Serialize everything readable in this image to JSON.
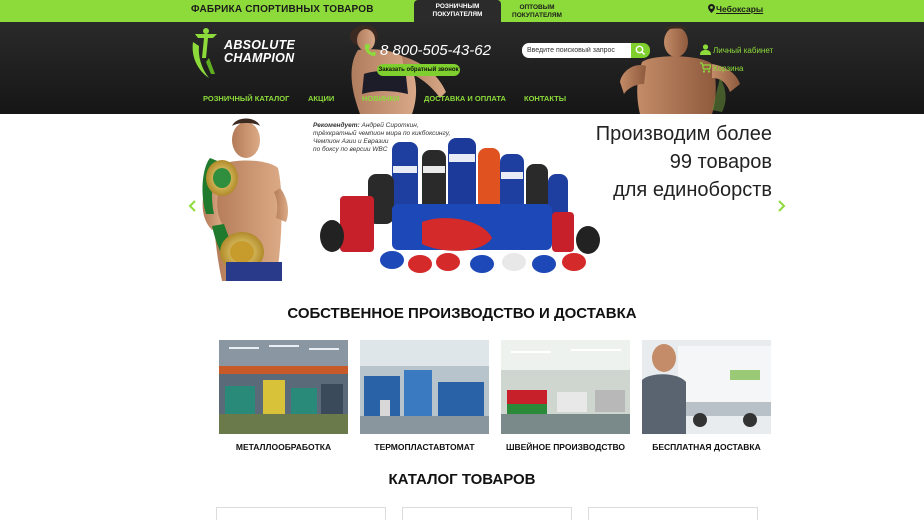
{
  "topbar": {
    "title": "ФАБРИКА СПОРТИВНЫХ ТОВАРОВ",
    "tab_retail_1": "РОЗНИЧНЫМ",
    "tab_retail_2": "ПОКУПАТЕЛЯМ",
    "tab_wholesale_1": "ОПТОВЫМ",
    "tab_wholesale_2": "ПОКУПАТЕЛЯМ",
    "city": "Чебоксары"
  },
  "header": {
    "logo_line1": "ABSOLUTE",
    "logo_line2": "CHAMPION",
    "phone": "8 800-505-43-62",
    "callback": "Заказать обратный звонок",
    "search_placeholder": "Введите поисковый запрос",
    "account": "Личный кабинет",
    "cart": "Корзина"
  },
  "nav": {
    "items": [
      "РОЗНИЧНЫЙ КАТАЛОГ",
      "АКЦИИ",
      "НОВИНКИ",
      "ДОСТАВКА И ОПЛАТА",
      "КОНТАКТЫ"
    ]
  },
  "banner": {
    "recommend_label": "Рекомендует:",
    "recommend_name": "Андрей Сироткин,",
    "recommend_line2": "трёхкратный чемпион мира по кикбоксингу,",
    "recommend_line3": "Чемпион Азии и Евразии",
    "recommend_line4": "по боксу по версии WBC",
    "promo_line1": "Производим более",
    "promo_line2": "99 товаров",
    "promo_line3": "для единоборств"
  },
  "production": {
    "heading": "СОБСТВЕННОЕ ПРОИЗВОДСТВО И ДОСТАВКА",
    "items": [
      "МЕТАЛЛООБРАБОТКА",
      "ТЕРМОПЛАСТАВТОМАТ",
      "ШВЕЙНОЕ ПРОИЗВОДСТВО",
      "БЕСПЛАТНАЯ ДОСТАВКА"
    ]
  },
  "catalog": {
    "heading": "КАТАЛОГ ТОВАРОВ"
  },
  "colors": {
    "accent": "#8ddb3b",
    "header_bg": "#1e1e1e"
  }
}
